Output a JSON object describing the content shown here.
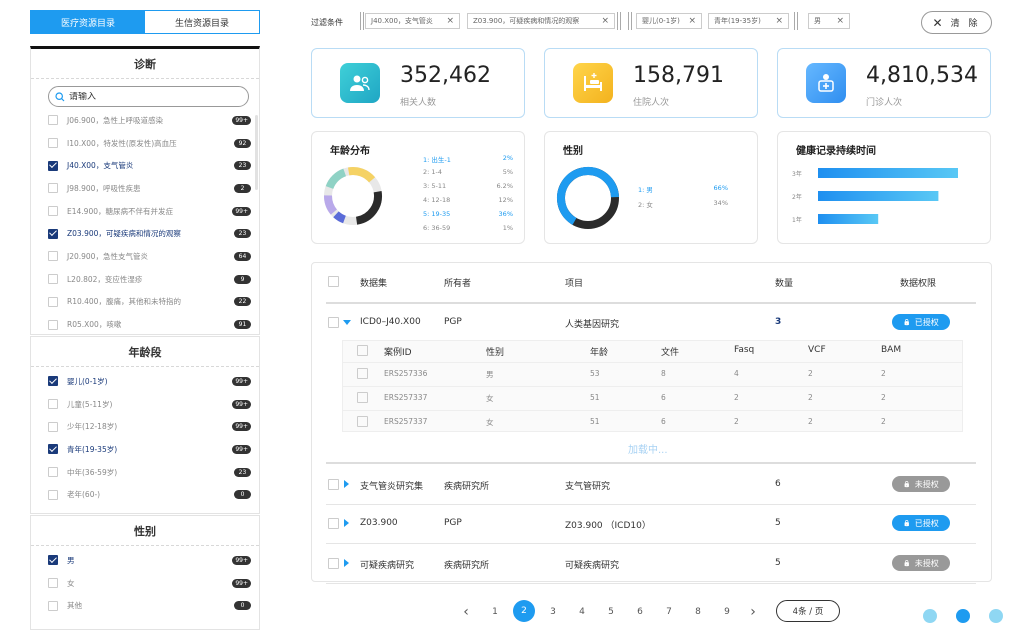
{
  "left": {
    "tabs": [
      "医疗资源目录",
      "生信资源目录"
    ],
    "diagnosis": {
      "title": "诊断",
      "search_placeholder": "请输入",
      "items": [
        {
          "label": "J06.900，急性上呼吸道感染",
          "count": "99+",
          "checked": false
        },
        {
          "label": "I10.X00，特发性(原发性)高血压",
          "count": "92",
          "checked": false
        },
        {
          "label": "J40.X00，支气管炎",
          "count": "23",
          "checked": true
        },
        {
          "label": "J98.900，呼吸性疾患",
          "count": "2",
          "checked": false
        },
        {
          "label": "E14.900，糖尿病不伴有并发症",
          "count": "99+",
          "checked": false
        },
        {
          "label": "Z03.900，可疑疾病和情况的观察",
          "count": "23",
          "checked": true
        },
        {
          "label": "J20.900，急性支气管炎",
          "count": "64",
          "checked": false
        },
        {
          "label": "L20.802，变应性湿疹",
          "count": "9",
          "checked": false
        },
        {
          "label": "R10.400，腹痛，其他和未特指的",
          "count": "22",
          "checked": false
        },
        {
          "label": "R05.X00，咳嗽",
          "count": "91",
          "checked": false
        }
      ]
    },
    "age": {
      "title": "年龄段",
      "items": [
        {
          "label": "婴儿(0-1岁)",
          "count": "99+",
          "checked": true
        },
        {
          "label": "儿童(5-11岁)",
          "count": "99+",
          "checked": false
        },
        {
          "label": "少年(12-18岁)",
          "count": "99+",
          "checked": false
        },
        {
          "label": "青年(19-35岁)",
          "count": "99+",
          "checked": true
        },
        {
          "label": "中年(36-59岁)",
          "count": "23",
          "checked": false
        },
        {
          "label": "老年(60-)",
          "count": "0",
          "checked": false
        }
      ]
    },
    "gender": {
      "title": "性别",
      "items": [
        {
          "label": "男",
          "count": "99+",
          "checked": true
        },
        {
          "label": "女",
          "count": "99+",
          "checked": false
        },
        {
          "label": "其他",
          "count": "0",
          "checked": false
        }
      ]
    }
  },
  "filters": {
    "label": "过滤条件",
    "chips": [
      "J40.X00，支气管炎",
      "Z03.900，可疑疾病和情况的观察",
      "婴儿(0-1岁)",
      "青年(19-35岁)",
      "男"
    ],
    "clear_label": "清 除"
  },
  "stats": [
    {
      "value": "352,462",
      "label": "相关人数",
      "icon": "people-icon",
      "color": "#25b5c8"
    },
    {
      "value": "158,791",
      "label": "住院人次",
      "icon": "hospital-bed-icon",
      "color": "#f6c33a"
    },
    {
      "value": "4,810,534",
      "label": "门诊人次",
      "icon": "clinic-icon",
      "color": "#3f9ef0"
    }
  ],
  "age_dist": {
    "title": "年龄分布",
    "rows": [
      {
        "label": "1:  出生-1",
        "value": "2%",
        "highlight": true
      },
      {
        "label": "2:  1-4",
        "value": "5%",
        "highlight": false
      },
      {
        "label": "3:  5-11",
        "value": "6.2%",
        "highlight": false
      },
      {
        "label": "4:  12-18",
        "value": "12%",
        "highlight": false
      },
      {
        "label": "5:  19-35",
        "value": "36%",
        "highlight": true
      },
      {
        "label": "6:  36-59",
        "value": "1%",
        "highlight": false
      }
    ]
  },
  "gender_dist": {
    "title": "性别",
    "rows": [
      {
        "label": "1:  男",
        "value": "66%",
        "highlight": true
      },
      {
        "label": "2:  女",
        "value": "34%",
        "highlight": false
      }
    ]
  },
  "chart_data": {
    "type": "bar",
    "title": "健康记录持续时间",
    "categories": [
      "3年",
      "2年",
      "1年"
    ],
    "values": [
      100,
      86,
      43
    ],
    "xlim": [
      0,
      100
    ]
  },
  "table": {
    "headers": [
      "数据集",
      "所有者",
      "项目",
      "数量",
      "数据权限"
    ],
    "rows": [
      {
        "dataset": "ICD0–J40.X00",
        "owner": "PGP",
        "project": "人类基因研究",
        "count": "3",
        "auth": "已授权",
        "authorized": true,
        "expanded": true
      },
      {
        "dataset": "支气管炎研究集",
        "owner": "疾病研究所",
        "project": "支气管研究",
        "count": "6",
        "auth": "未授权",
        "authorized": false,
        "expanded": false
      },
      {
        "dataset": "Z03.900",
        "owner": "PGP",
        "project": "Z03.900 （ICD10）",
        "count": "5",
        "auth": "已授权",
        "authorized": true,
        "expanded": false
      },
      {
        "dataset": "可疑疾病研究",
        "owner": "疾病研究所",
        "project": "可疑疾病研究",
        "count": "5",
        "auth": "未授权",
        "authorized": false,
        "expanded": false
      }
    ],
    "sub_headers": [
      "案例ID",
      "性别",
      "年龄",
      "文件",
      "Fasq",
      "VCF",
      "BAM"
    ],
    "sub_rows": [
      [
        "ERS257336",
        "男",
        "53",
        "8",
        "4",
        "2",
        "2"
      ],
      [
        "ERS257337",
        "女",
        "51",
        "6",
        "2",
        "2",
        "2"
      ],
      [
        "ERS257337",
        "女",
        "51",
        "6",
        "2",
        "2",
        "2"
      ]
    ],
    "loading": "加载中..."
  },
  "pagination": {
    "pages": [
      "1",
      "2",
      "3",
      "4",
      "5",
      "6",
      "7",
      "8",
      "9"
    ],
    "current": "2",
    "page_size": "4条 / 页"
  },
  "dot_colors": [
    "#8fd7f3",
    "#1e9bf0",
    "#8fd7f3"
  ]
}
